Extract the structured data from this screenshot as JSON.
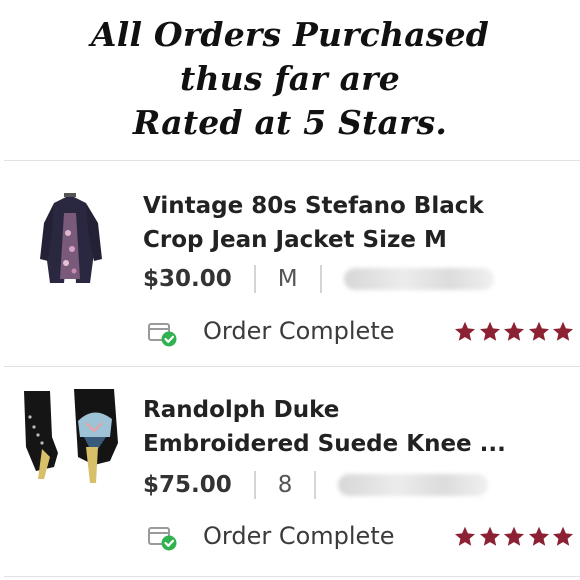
{
  "headline": {
    "line1": "All Orders Purchased",
    "line2": "thus far are",
    "line3": "Rated at 5 Stars."
  },
  "orders": [
    {
      "title_line1": "Vintage 80s Stefano Black",
      "title_line2": "Crop Jean Jacket Size M",
      "price": "$30.00",
      "size": "M",
      "seller": "@",
      "status": "Order Complete",
      "rating": 5,
      "thumb_icon": "jacket-icon"
    },
    {
      "title_line1": "Randolph Duke",
      "title_line2": "Embroidered Suede Knee ...",
      "price": "$75.00",
      "size": "8",
      "seller": "@",
      "status": "Order Complete",
      "rating": 5,
      "thumb_icon": "boots-icon"
    }
  ],
  "colors": {
    "star": "#8c2134",
    "check": "#2fb24f",
    "text": "#222222"
  }
}
